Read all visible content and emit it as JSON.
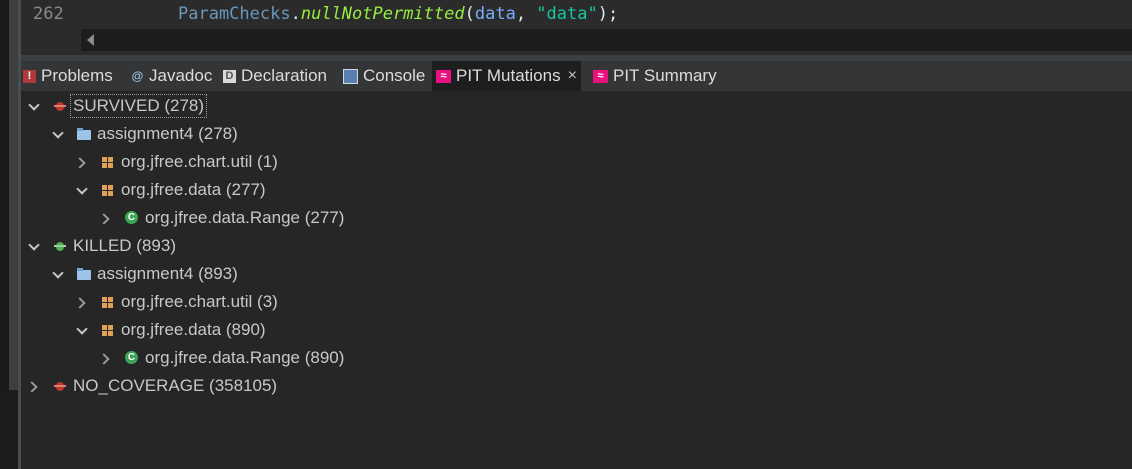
{
  "editor": {
    "line_number": "262",
    "code": {
      "class_name": "ParamChecks",
      "dot": ".",
      "method": "nullNotPermitted",
      "open": "(",
      "arg": "data",
      "comma": ", ",
      "string": "\"data\"",
      "close": ");"
    }
  },
  "tabs": [
    {
      "label": "Problems",
      "icon": "problems-icon"
    },
    {
      "label": "Javadoc",
      "icon": "javadoc-icon"
    },
    {
      "label": "Declaration",
      "icon": "declaration-icon"
    },
    {
      "label": "Console",
      "icon": "console-icon"
    },
    {
      "label": "PIT Mutations",
      "icon": "pit-icon",
      "active": true
    },
    {
      "label": "PIT Summary",
      "icon": "pit-icon"
    }
  ],
  "tree": [
    {
      "label": "SURVIVED (278)",
      "icon": "bug-red-icon",
      "level": 0,
      "expanded": true
    },
    {
      "label": "assignment4 (278)",
      "icon": "folder-icon",
      "level": 1,
      "expanded": true
    },
    {
      "label": "org.jfree.chart.util (1)",
      "icon": "package-icon",
      "level": 2,
      "expanded": false
    },
    {
      "label": "org.jfree.data (277)",
      "icon": "package-icon",
      "level": 2,
      "expanded": true
    },
    {
      "label": "org.jfree.data.Range (277)",
      "icon": "class-icon",
      "level": 3,
      "expanded": false
    },
    {
      "label": "KILLED (893)",
      "icon": "bug-green-icon",
      "level": 0,
      "expanded": true
    },
    {
      "label": "assignment4 (893)",
      "icon": "folder-icon",
      "level": 1,
      "expanded": true
    },
    {
      "label": "org.jfree.chart.util (3)",
      "icon": "package-icon",
      "level": 2,
      "expanded": false
    },
    {
      "label": "org.jfree.data (890)",
      "icon": "package-icon",
      "level": 2,
      "expanded": true
    },
    {
      "label": "org.jfree.data.Range (890)",
      "icon": "class-icon",
      "level": 3,
      "expanded": false
    },
    {
      "label": "NO_COVERAGE (358105)",
      "icon": "bug-red-icon",
      "level": 0,
      "expanded": false
    }
  ],
  "colors": {
    "accent": "#5a8fd0",
    "pit_icon": "#e8117f",
    "background": "#262626"
  }
}
